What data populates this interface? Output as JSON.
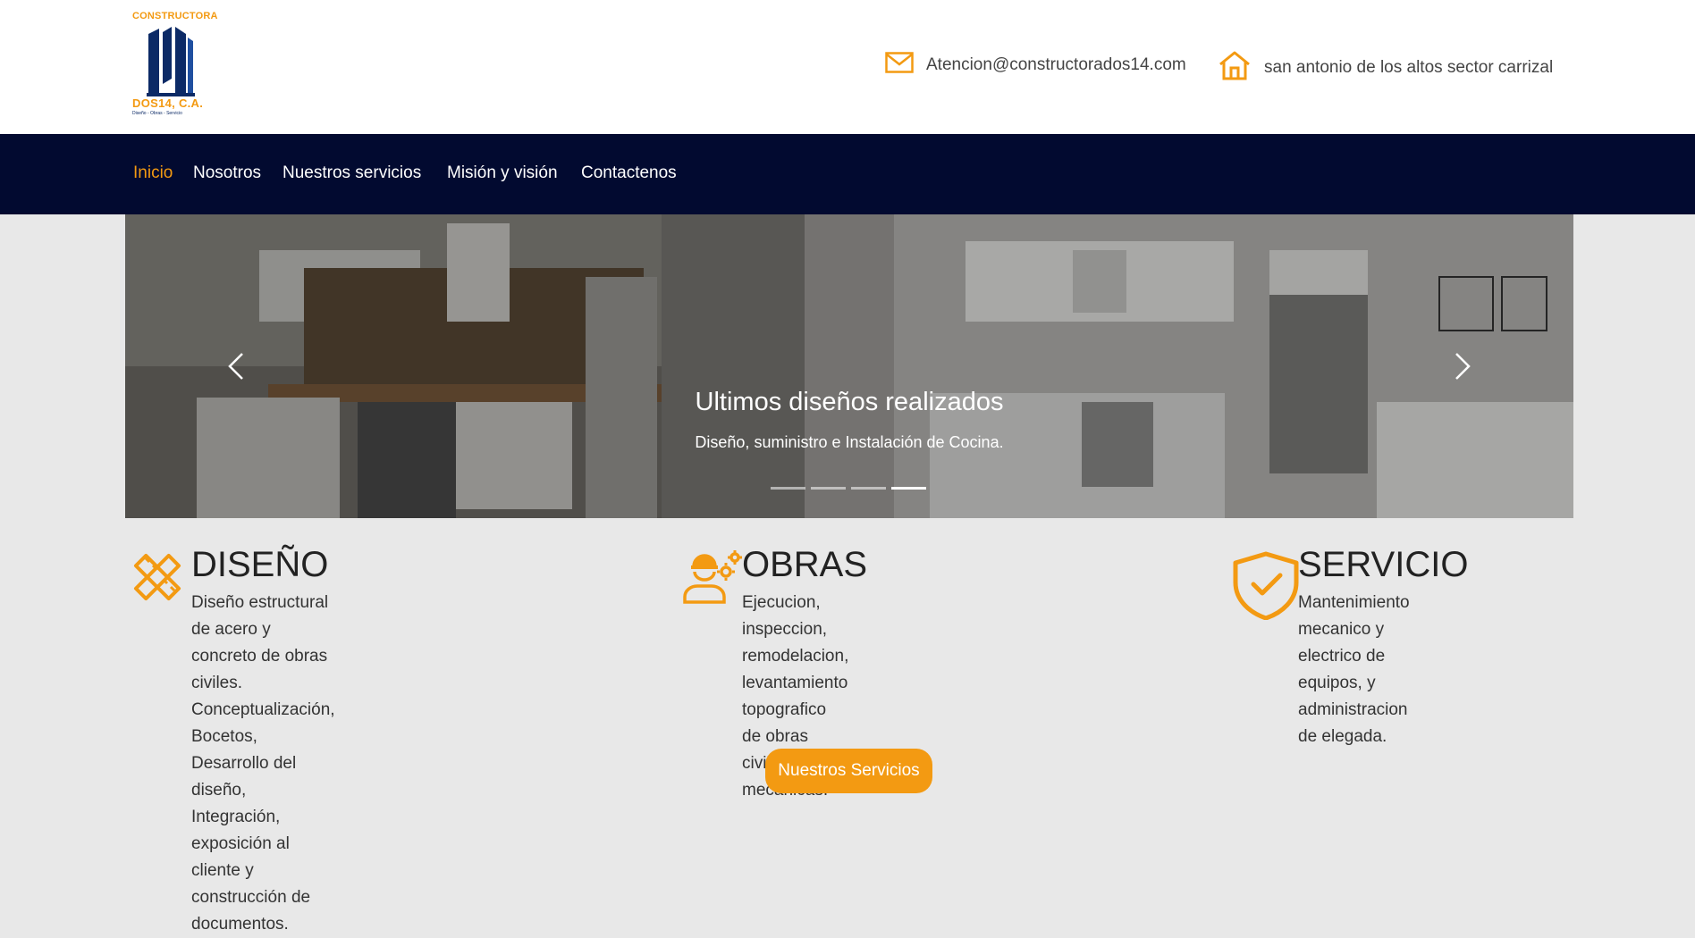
{
  "brand": {
    "top_text": "CONSTRUCTORA",
    "name": "DOS14, C.A.",
    "tagline": "Diseño - Obras - Servicio"
  },
  "contact": {
    "email": "Atencion@constructorados14.com",
    "address": "san antonio de los altos sector carrizal",
    "email_icon": "mail-icon",
    "address_icon": "home-icon"
  },
  "nav": {
    "items": [
      {
        "label": "Inicio",
        "active": true
      },
      {
        "label": "Nosotros"
      },
      {
        "label": "Nuestros servicios"
      },
      {
        "label": "Misión y visión"
      },
      {
        "label": "Contactenos"
      }
    ]
  },
  "carousel": {
    "title": "Ultimos diseños realizados",
    "text": "Diseño, suministro e Instalación de Cocina.",
    "slides_count": 4,
    "active_slide": 4
  },
  "features": [
    {
      "title": "DISEÑO",
      "icon": "ruler-pencil-icon",
      "lines": [
        "Diseño estructural de acero y",
        "concreto de obras civiles.",
        "Conceptualización, Bocetos,",
        "Desarrollo del diseño, Integración,",
        "exposición al cliente y",
        "construcción de documentos."
      ]
    },
    {
      "title": "OBRAS",
      "icon": "worker-gears-icon",
      "lines": [
        "Ejecucion, inspeccion,",
        "remodelacion, levantamiento",
        "topografico de obras civiles y",
        "mecanicas."
      ]
    },
    {
      "title": "SERVICIO",
      "icon": "shield-check-icon",
      "lines": [
        "Mantenimiento mecanico y",
        "electrico de equipos, y",
        "administracion de elegada."
      ]
    }
  ],
  "cta": {
    "label": "Nuestros Servicios"
  },
  "colors": {
    "accent": "#f39a12",
    "nav_bg": "#020a30",
    "page_bg": "#e8e8e8",
    "logo_blue": "#0c2a66"
  }
}
